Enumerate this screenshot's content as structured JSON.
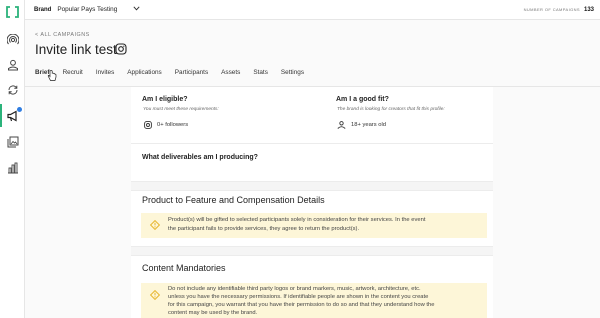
{
  "topbar": {
    "brand_label": "Brand",
    "brand_name": "Popular Pays Testing",
    "campaigns_label": "NUMBER OF CAMPAIGNS",
    "campaigns_count": "133"
  },
  "header": {
    "back_link": "< ALL CAMPAIGNS",
    "title": "Invite link test"
  },
  "tabs": [
    "Brief",
    "Recruit",
    "Invites",
    "Applications",
    "Participants",
    "Assets",
    "Stats",
    "Settings"
  ],
  "active_tab": "Brief",
  "rail": {
    "icons": [
      "broadcast-icon",
      "person-icon",
      "sync-icon",
      "megaphone-icon",
      "gallery-icon",
      "bar-chart-icon"
    ],
    "active": "megaphone-icon",
    "notification_color": "#2f7de1"
  },
  "colors": {
    "accent": "#2bb37b",
    "notice_bg": "#fdf6d8",
    "notice_icon": "#e8b730"
  },
  "brief": {
    "eligible": {
      "heading": "Am I eligible?",
      "subtitle": "You must meet these requirements:",
      "requirement": "0+ followers"
    },
    "good_fit": {
      "heading": "Am I a good fit?",
      "subtitle": "The brand is looking for creators that fit this profile:",
      "requirement": "18+ years old"
    },
    "deliverables_heading": "What deliverables am I producing?",
    "product_section": {
      "heading": "Product to Feature and Compensation Details",
      "notice_line1": "Product(s) will be gifted to selected participants solely in consideration for their services. In the event",
      "notice_line2": "the participant fails to provide services, they agree to return the product(s)."
    },
    "content_section": {
      "heading": "Content Mandatories",
      "notice_line1": "Do not include any identifiable third party logos or brand markers, music, artwork, architecture, etc.",
      "notice_line2": "unless you have the necessary permissions. If identifiable people are shown in the content you create",
      "notice_line3": "for this campaign, you warrant that you have their permission to do so and that they understand how the",
      "notice_line4": "content may be used by the brand."
    }
  }
}
